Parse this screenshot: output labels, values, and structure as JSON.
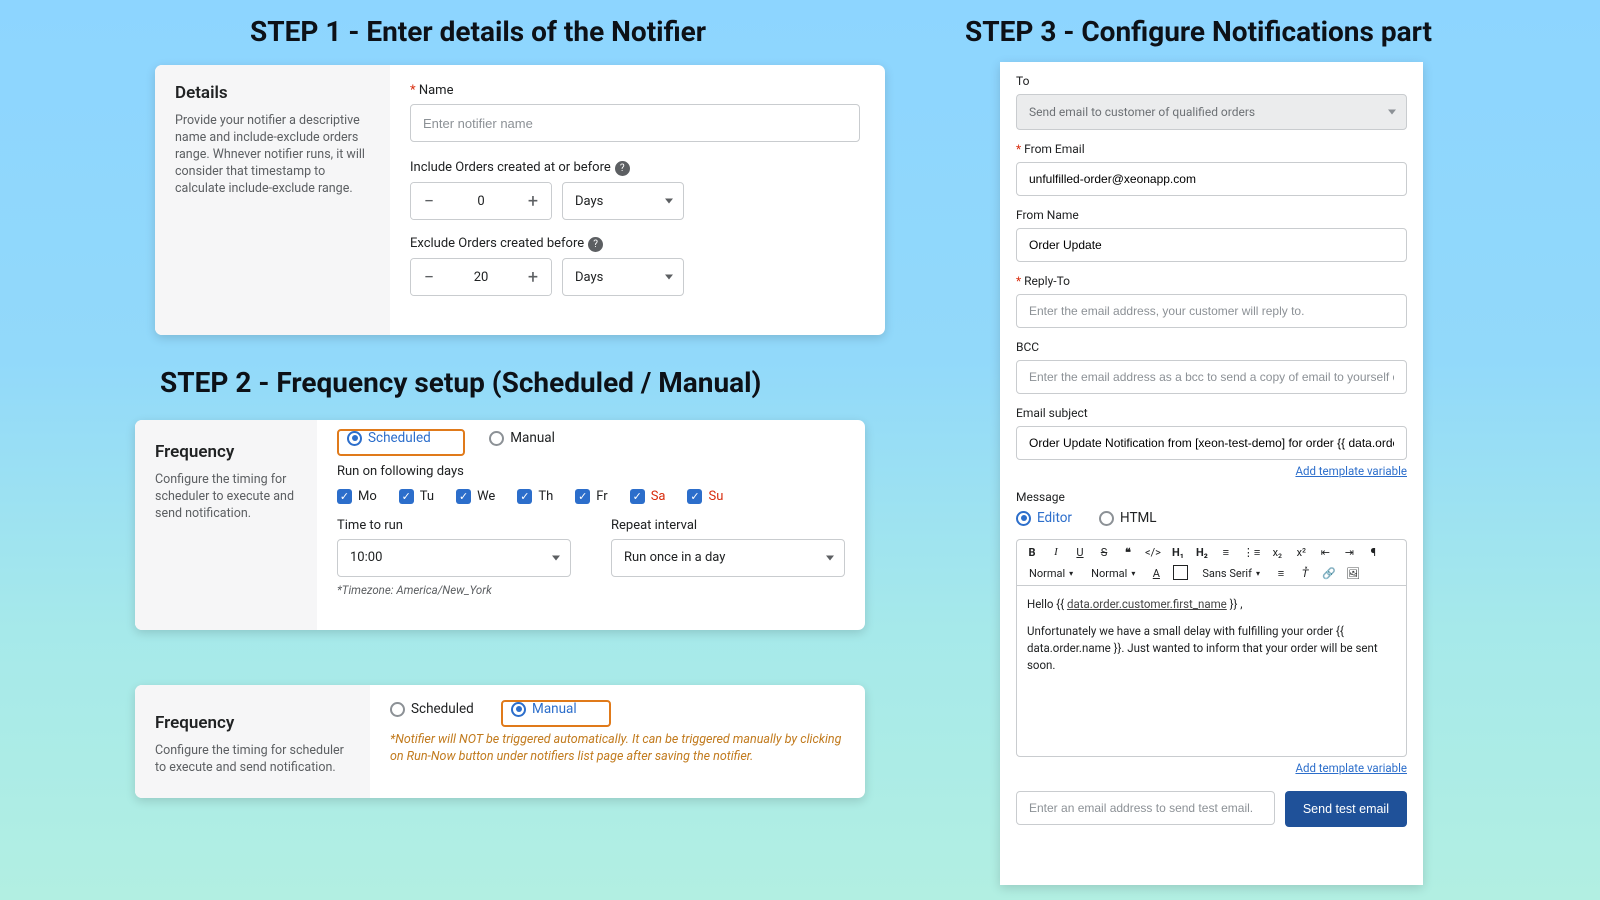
{
  "headings": {
    "step1": "STEP 1 - Enter details of the Notifier",
    "step2": "STEP 2 - Frequency setup (Scheduled / Manual)",
    "step3": "STEP 3  - Configure Notifications part"
  },
  "step1": {
    "sidebar_title": "Details",
    "sidebar_desc": "Provide your notifier a descriptive name and include-exclude orders range. Whnever notifier runs, it will consider that timestamp to calculate include-exclude range.",
    "name_label": "Name",
    "name_placeholder": "Enter notifier name",
    "include_label": "Include Orders created at or before",
    "include_value": "0",
    "include_unit": "Days",
    "exclude_label": "Exclude Orders created before",
    "exclude_value": "20",
    "exclude_unit": "Days"
  },
  "step2a": {
    "sidebar_title": "Frequency",
    "sidebar_desc": "Configure the timing for scheduler to execute and send notification.",
    "radio_scheduled": "Scheduled",
    "radio_manual": "Manual",
    "run_days_label": "Run on following days",
    "days": [
      "Mo",
      "Tu",
      "We",
      "Th",
      "Fr",
      "Sa",
      "Su"
    ],
    "time_label": "Time to run",
    "time_value": "10:00",
    "repeat_label": "Repeat interval",
    "repeat_value": "Run once in a day",
    "tz_note": "*Timezone: America/New_York"
  },
  "step2b": {
    "sidebar_title": "Frequency",
    "sidebar_desc": "Configure the timing for scheduler to execute and send notification.",
    "radio_scheduled": "Scheduled",
    "radio_manual": "Manual",
    "warning": "*Notifier will NOT be triggered automatically. It can be triggered manually by clicking on Run-Now button under notifiers list page after saving the notifier."
  },
  "step3": {
    "to_label": "To",
    "to_value": "Send email to customer of qualified orders",
    "from_email_label": "From Email",
    "from_email_value": "unfulfilled-order@xeonapp.com",
    "from_name_label": "From Name",
    "from_name_value": "Order Update",
    "reply_to_label": "Reply-To",
    "reply_to_placeholder": "Enter the email address, your customer will reply to.",
    "bcc_label": "BCC",
    "bcc_placeholder": "Enter the email address as a bcc to send a copy of email to yourself or your team",
    "subject_label": "Email subject",
    "subject_value": "Order Update Notification from [xeon-test-demo] for order {{ data.order.name }}",
    "add_template_link": "Add template variable",
    "message_label": "Message",
    "msg_radio_editor": "Editor",
    "msg_radio_html": "HTML",
    "toolbar_font": "Sans Serif",
    "toolbar_size1": "Normal",
    "toolbar_size2": "Normal",
    "body_hello_prefix": "Hello {{ ",
    "body_hello_var": "data.order.customer.first_name",
    "body_hello_suffix": " }} ,",
    "body_para": "Unfortunately we have a small delay with fulfilling your order {{ data.order.name }}. Just wanted to inform that your order will be sent soon.",
    "test_placeholder": "Enter an email address to send test email.",
    "send_test_label": "Send test email"
  }
}
